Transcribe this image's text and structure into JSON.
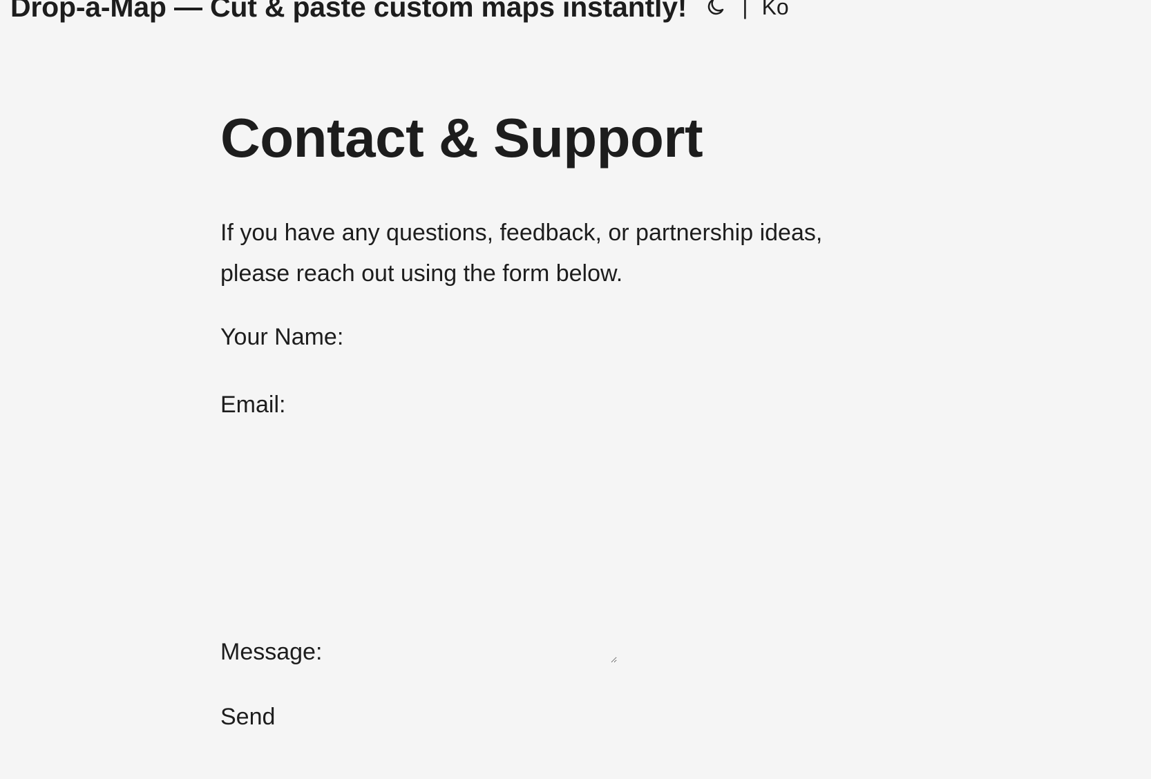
{
  "header": {
    "site_title": "Drop-a-Map — Cut & paste custom maps instantly!",
    "theme_toggle_icon": "moon-icon",
    "divider": "|",
    "language_label": "Ko"
  },
  "main": {
    "title": "Contact & Support",
    "intro": "If you have any questions, feedback, or partnership ideas, please reach out using the form below."
  },
  "form": {
    "name_label": "Your Name:",
    "email_label": "Email:",
    "message_label": "Message:",
    "message_value": "",
    "send_label": "Send"
  }
}
